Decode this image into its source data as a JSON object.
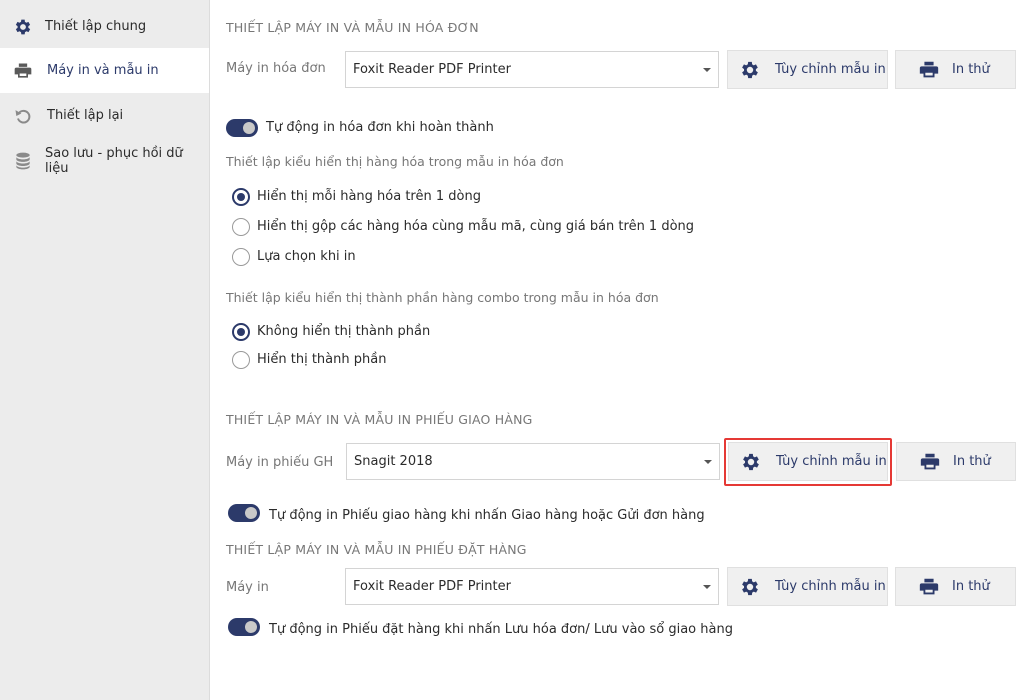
{
  "sidebar": {
    "items": [
      {
        "label": "Thiết lập chung",
        "icon": "gear-icon"
      },
      {
        "label": "Máy in và mẫu in",
        "icon": "printer-icon"
      },
      {
        "label": "Thiết lập lại",
        "icon": "reset-icon"
      },
      {
        "label": "Sao lưu - phục hồi dữ liệu",
        "icon": "database-icon"
      }
    ]
  },
  "invoice": {
    "title": "THIẾT LẬP MÁY IN VÀ MẪU IN HÓA ĐƠN",
    "printer_label": "Máy in hóa đơn",
    "printer_value": "Foxit Reader PDF Printer",
    "customize_label": "Tùy chỉnh mẫu in",
    "test_label": "In thử",
    "auto_print_label": "Tự động in hóa đơn khi hoàn thành",
    "display_heading": "Thiết lập kiểu hiển thị hàng hóa trong mẫu in hóa đơn",
    "display_options": [
      {
        "label": "Hiển thị mỗi hàng hóa trên 1 dòng",
        "checked": true
      },
      {
        "label": "Hiển thị gộp các hàng hóa cùng mẫu mã, cùng giá bán trên 1 dòng",
        "checked": false
      },
      {
        "label": "Lựa chọn khi in",
        "checked": false
      }
    ],
    "combo_heading": "Thiết lập kiểu hiển thị thành phần hàng combo trong mẫu in hóa đơn",
    "combo_options": [
      {
        "label": "Không hiển thị thành phần",
        "checked": true
      },
      {
        "label": "Hiển thị thành phần",
        "checked": false
      }
    ]
  },
  "delivery": {
    "title": "THIẾT LẬP MÁY IN VÀ MẪU IN PHIẾU GIAO HÀNG",
    "printer_label": "Máy in phiếu GH",
    "printer_value": "Snagit 2018",
    "customize_label": "Tùy chỉnh mẫu in",
    "test_label": "In thử",
    "auto_print_label": "Tự động in Phiếu giao hàng khi nhấn Giao hàng hoặc Gửi đơn hàng"
  },
  "order": {
    "title": "THIẾT LẬP MÁY IN VÀ MẪU IN PHIẾU ĐẶT HÀNG",
    "printer_label": "Máy in",
    "printer_value": "Foxit Reader PDF Printer",
    "customize_label": "Tùy chỉnh mẫu in",
    "test_label": "In thử",
    "auto_print_label": "Tự động in Phiếu đặt hàng khi nhấn Lưu hóa đơn/ Lưu vào sổ giao hàng"
  },
  "colors": {
    "accent": "#2c3a6a",
    "highlight": "#e53935"
  }
}
